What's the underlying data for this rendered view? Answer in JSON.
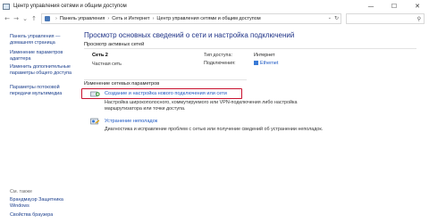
{
  "window": {
    "title": "Центр управления сетями и общим доступом",
    "minimize": "—",
    "maximize": "☐",
    "close": "✕"
  },
  "nav": {
    "back": "←",
    "forward": "→",
    "recent": "⌄",
    "up": "↑",
    "breadcrumbs": [
      "Панель управления",
      "Сеть и Интернет",
      "Центр управления сетями и общим доступом"
    ],
    "separator": "›",
    "dropdown": "⌄",
    "refresh": "↻",
    "search_icon": "⚲",
    "search_placeholder": ""
  },
  "sidebar": {
    "links": [
      {
        "label": "Панель управления — домашняя страница"
      },
      {
        "label": "Изменение параметров адаптера"
      },
      {
        "label": "Изменить дополнительные параметры общего доступа"
      },
      {
        "label": "Параметры потоковой передачи мультимедиа"
      }
    ],
    "see_also_label": "См. также",
    "see_also": [
      {
        "label": "Брандмауэр Защитника Windows"
      },
      {
        "label": "Свойства браузера"
      }
    ]
  },
  "main": {
    "title": "Просмотр основных сведений о сети и настройка подключений",
    "active_networks_header": "Просмотр активных сетей",
    "network": {
      "name": "Сеть 2",
      "type": "Частная сеть",
      "access_type_label": "Тип доступа:",
      "access_type_value": "Интернет",
      "connections_label": "Подключения:",
      "connections_value": "Ethernet"
    },
    "change_settings_header": "Изменение сетевых параметров",
    "tasks": [
      {
        "link": "Создание и настройка нового подключения или сети",
        "desc": "Настройка широкополосного, коммутируемого или VPN-подключения либо настройка маршрутизатора или точки доступа.",
        "icon": "new-connection-icon"
      },
      {
        "link": "Устранение неполадок",
        "desc": "Диагностика и исправление проблем с сетью или получение сведений об устранении неполадок.",
        "icon": "troubleshoot-icon"
      }
    ]
  },
  "colors": {
    "link": "#1a56c2",
    "title": "#1e3287",
    "highlight": "#c8102e"
  }
}
